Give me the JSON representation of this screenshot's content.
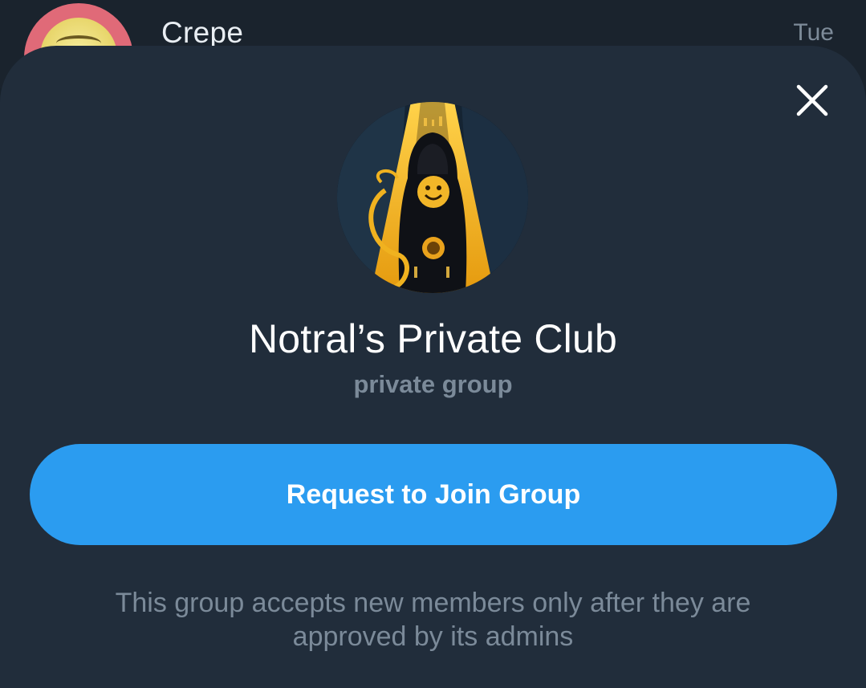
{
  "background_chat": {
    "name": "Crepe",
    "time": "Tue"
  },
  "sheet": {
    "close_icon": "close-icon",
    "group_title": "Notral’s Private Club",
    "group_subtitle": "private group",
    "join_button_label": "Request to Join Group",
    "note_line1": "This group accepts new members only after they are",
    "note_line2": "approved by its admins"
  },
  "colors": {
    "sheet_bg": "#212d3b",
    "accent": "#2b9cf0",
    "secondary_text": "#7b8a99"
  }
}
